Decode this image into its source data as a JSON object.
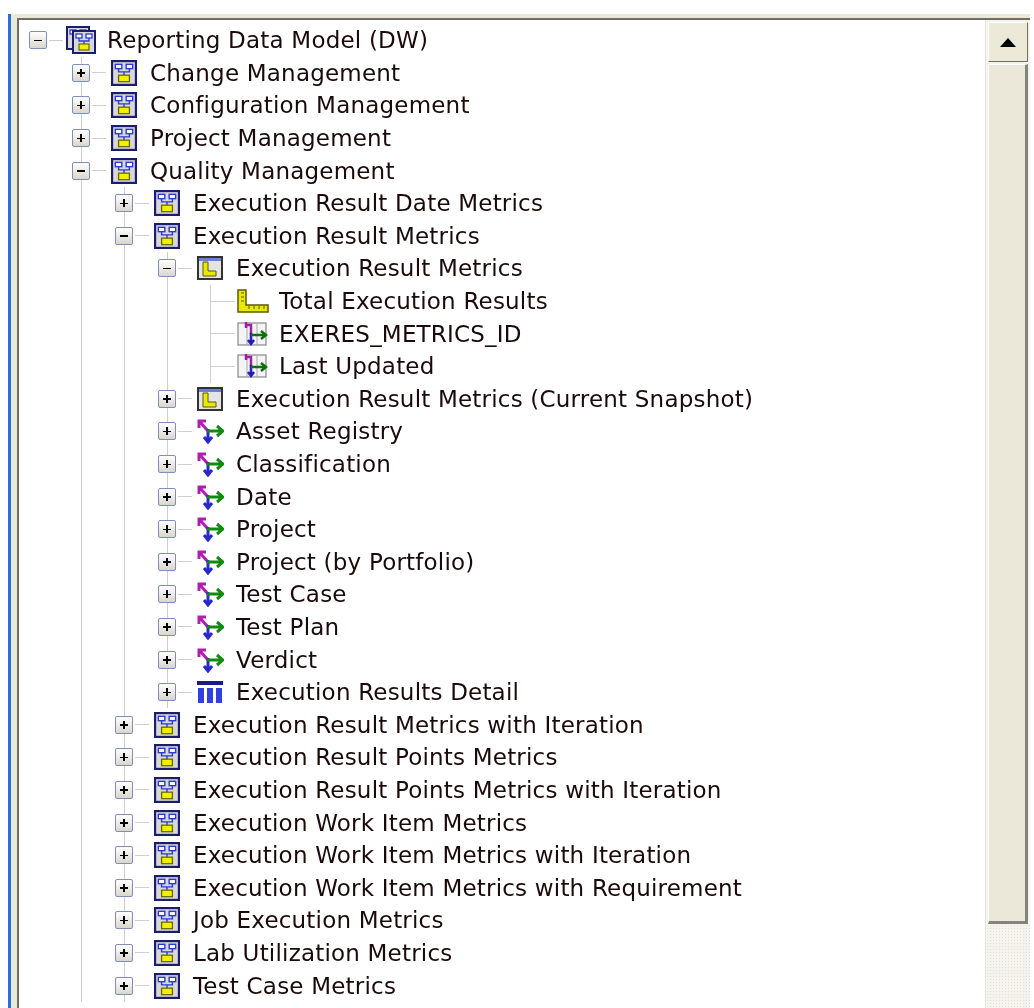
{
  "tree": {
    "label": "Reporting Data Model (DW)",
    "kind": "root",
    "expanded": true,
    "children": [
      {
        "label": "Change Management",
        "kind": "model",
        "expanded": false
      },
      {
        "label": "Configuration Management",
        "kind": "model",
        "expanded": false
      },
      {
        "label": "Project Management",
        "kind": "model",
        "expanded": false
      },
      {
        "label": "Quality Management",
        "kind": "model",
        "expanded": true,
        "children": [
          {
            "label": "Execution Result Date Metrics",
            "kind": "model",
            "expanded": false
          },
          {
            "label": "Execution Result Metrics",
            "kind": "model",
            "expanded": true,
            "children": [
              {
                "label": "Execution Result Metrics",
                "kind": "fact",
                "expanded": true,
                "children": [
                  {
                    "label": "Total Execution Results",
                    "kind": "measure"
                  },
                  {
                    "label": "EXERES_METRICS_ID",
                    "kind": "attribute"
                  },
                  {
                    "label": "Last Updated",
                    "kind": "attribute"
                  }
                ]
              },
              {
                "label": "Execution Result Metrics (Current Snapshot)",
                "kind": "fact",
                "expanded": false
              },
              {
                "label": "Asset Registry",
                "kind": "dimension",
                "expanded": false
              },
              {
                "label": "Classification",
                "kind": "dimension",
                "expanded": false
              },
              {
                "label": "Date",
                "kind": "dimension",
                "expanded": false
              },
              {
                "label": "Project",
                "kind": "dimension",
                "expanded": false
              },
              {
                "label": "Project (by Portfolio)",
                "kind": "dimension",
                "expanded": false
              },
              {
                "label": "Test Case",
                "kind": "dimension",
                "expanded": false
              },
              {
                "label": "Test Plan",
                "kind": "dimension",
                "expanded": false
              },
              {
                "label": "Verdict",
                "kind": "dimension",
                "expanded": false
              },
              {
                "label": "Execution Results Detail",
                "kind": "detail",
                "expanded": false
              }
            ]
          },
          {
            "label": "Execution Result Metrics with Iteration",
            "kind": "model",
            "expanded": false
          },
          {
            "label": "Execution Result Points Metrics",
            "kind": "model",
            "expanded": false
          },
          {
            "label": "Execution Result Points Metrics with Iteration",
            "kind": "model",
            "expanded": false
          },
          {
            "label": "Execution Work Item Metrics",
            "kind": "model",
            "expanded": false
          },
          {
            "label": "Execution Work Item Metrics with Iteration",
            "kind": "model",
            "expanded": false
          },
          {
            "label": "Execution Work Item Metrics with Requirement",
            "kind": "model",
            "expanded": false
          },
          {
            "label": "Job Execution Metrics",
            "kind": "model",
            "expanded": false
          },
          {
            "label": "Lab Utilization Metrics",
            "kind": "model",
            "expanded": false
          },
          {
            "label": "Test Case Metrics",
            "kind": "model",
            "expanded": false
          }
        ]
      }
    ]
  }
}
